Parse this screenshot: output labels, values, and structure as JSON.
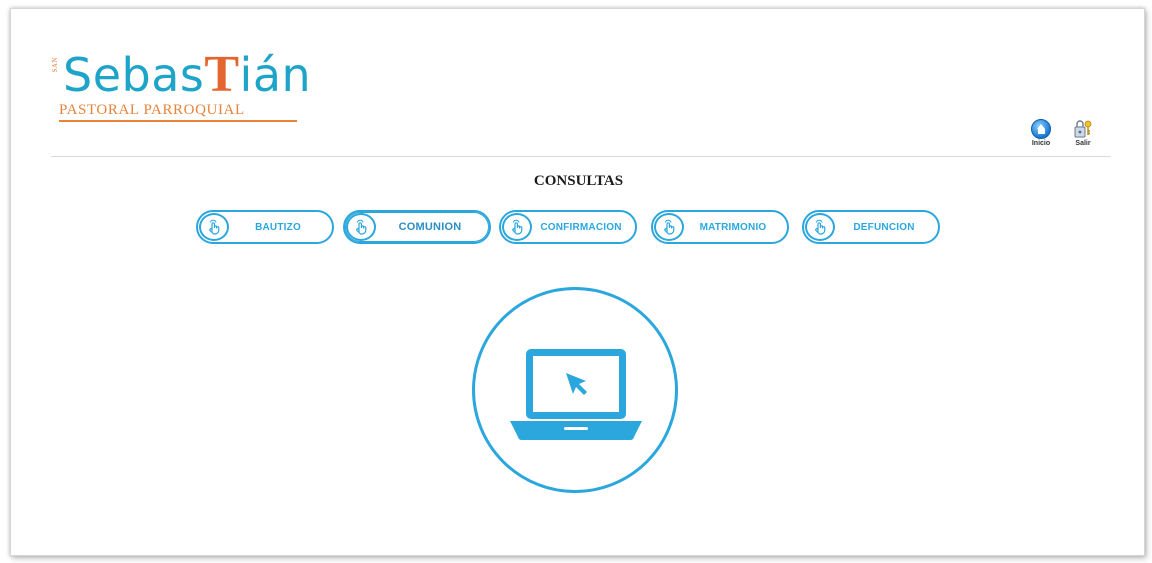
{
  "logo": {
    "vertical_text": "SAN",
    "word_part1": "Sebas",
    "word_t": "T",
    "word_part2": "ián",
    "subtitle": "PASTORAL PARROQUIAL",
    "colors": {
      "blue": "#1ea4c9",
      "orange": "#e8833a"
    }
  },
  "nav": {
    "inicio_label": "Inicio",
    "salir_label": "Salir",
    "inicio_icon": "home-icon",
    "salir_icon": "key-lock-icon"
  },
  "page": {
    "title": "CONSULTAS"
  },
  "buttons": [
    {
      "label": "BAUTIZO",
      "icon": "hand-pointer-icon",
      "active": false
    },
    {
      "label": "COMUNION",
      "icon": "hand-pointer-icon",
      "active": true
    },
    {
      "label": "CONFIRMACION",
      "icon": "hand-pointer-icon",
      "active": false
    },
    {
      "label": "MATRIMONIO",
      "icon": "hand-pointer-icon",
      "active": false
    },
    {
      "label": "DEFUNCION",
      "icon": "hand-pointer-icon",
      "active": false
    }
  ],
  "hero": {
    "icon": "laptop-cursor-icon"
  },
  "theme": {
    "accent": "#2ba7de"
  }
}
